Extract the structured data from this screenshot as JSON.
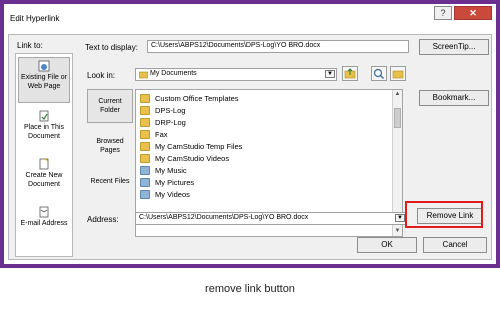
{
  "dialog": {
    "title": "Edit Hyperlink",
    "help_glyph": "?",
    "close_glyph": "✕"
  },
  "link_to": {
    "label": "Link to:",
    "items": [
      {
        "label": "Existing File or Web Page",
        "icon": "web-page-icon"
      },
      {
        "label": "Place in This Document",
        "icon": "document-place-icon"
      },
      {
        "label": "Create New Document",
        "icon": "new-document-icon"
      },
      {
        "label": "E-mail Address",
        "icon": "email-icon"
      }
    ]
  },
  "text_to_display": {
    "label": "Text to display:",
    "value": "C:\\Users\\ABPS12\\Documents\\DPS-Log\\YO BRO.docx"
  },
  "screen_tip_label": "ScreenTip...",
  "look_in": {
    "label": "Look in:",
    "value": "My Documents"
  },
  "bookmark_label": "Bookmark...",
  "left_nav": [
    {
      "label": "Current Folder"
    },
    {
      "label": "Browsed Pages"
    },
    {
      "label": "Recent Files"
    }
  ],
  "files": [
    {
      "name": "Custom Office Templates",
      "icon": "folder-icon"
    },
    {
      "name": "DPS-Log",
      "icon": "folder-icon"
    },
    {
      "name": "DRP-Log",
      "icon": "folder-icon"
    },
    {
      "name": "Fax",
      "icon": "folder-icon"
    },
    {
      "name": "My CamStudio Temp Files",
      "icon": "folder-icon"
    },
    {
      "name": "My CamStudio Videos",
      "icon": "folder-icon"
    },
    {
      "name": "My Music",
      "icon": "music-folder-icon"
    },
    {
      "name": "My Pictures",
      "icon": "pictures-folder-icon"
    },
    {
      "name": "My Videos",
      "icon": "videos-folder-icon"
    }
  ],
  "address": {
    "label": "Address:",
    "value": "C:\\Users\\ABPS12\\Documents\\DPS-Log\\YO BRO.docx"
  },
  "remove_link_label": "Remove Link",
  "ok_label": "OK",
  "cancel_label": "Cancel",
  "caption": "remove link button",
  "colors": {
    "frame": "#6b2f8f",
    "highlight": "#e01b1b"
  }
}
